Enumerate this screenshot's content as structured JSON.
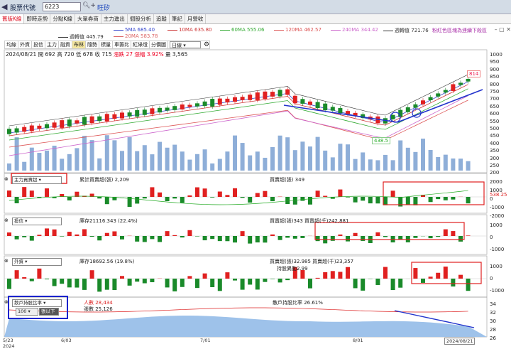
{
  "header": {
    "back_icon": "chevron-left",
    "label": "股票代號",
    "code": "6223",
    "stock_name": "旺矽"
  },
  "tabs": [
    "舊版K線",
    "即時走勢",
    "分點K線",
    "大單券商",
    "主力進出",
    "個股分析",
    "追蹤",
    "筆記",
    "月營收"
  ],
  "ma_legend": {
    "ma5": {
      "label": "5MA",
      "value": "685.40",
      "color": "#3344cc"
    },
    "ma10": {
      "label": "10MA",
      "value": "635.80",
      "color": "#cc3333"
    },
    "ma20": {
      "label": "20MA",
      "value": "583.78",
      "color": "#dd6666"
    },
    "ma60": {
      "label": "60MA",
      "value": "555.06",
      "color": "#33aa33"
    },
    "ma120": {
      "label": "120MA",
      "value": "462.57",
      "color": "#dd5555"
    },
    "ma240": {
      "label": "240MA",
      "value": "344.42",
      "color": "#cc66cc"
    },
    "vol": {
      "label": "週轉值",
      "value": "721.76",
      "color": "#333333"
    },
    "vol2": {
      "label": "週轉值",
      "value": "445.79",
      "color": "#333333"
    }
  },
  "hint": "粉紅色區塊為連續下殺區",
  "subtabs": [
    "均線",
    "外資",
    "投信",
    "主力",
    "融資",
    "布林",
    "隨勢",
    "標量",
    "車籌比",
    "紅綠燈",
    "分價圖"
  ],
  "subtab_active": "布林",
  "period": "日線",
  "info": {
    "date": "2024/08/21",
    "open_label": "開",
    "open": "692",
    "high_label": "高",
    "high": "720",
    "low_label": "低",
    "low": "678",
    "close_label": "收",
    "close": "715",
    "chg_label": "漲跌",
    "chg": "27",
    "pct_label": "漲幅",
    "pct": "3.92%",
    "vol_label": "量",
    "vol": "3,565"
  },
  "price_axis": [
    "1000",
    "950",
    "900",
    "850",
    "800",
    "750",
    "700",
    "650",
    "600",
    "550",
    "500",
    "450",
    "400",
    "350",
    "300",
    "250",
    "200"
  ],
  "price_marks": {
    "high": "814",
    "low": "438.5"
  },
  "panels": {
    "p1": {
      "select": "主力買賣超",
      "legend1": "累計買賣超(張) 2,209",
      "legend2": "買賣超(張) 349",
      "value": "538.25",
      "axis": [
        "2000",
        "1000",
        "0",
        "-1000",
        "-2000"
      ]
    },
    "p2": {
      "select": "投信",
      "legend1": "庫存21116.343 (22.4%)",
      "legend2": "買賣超(張)343 買賣超(千)242,881",
      "axis": [
        "1000",
        "0",
        "-1000"
      ]
    },
    "p3": {
      "select": "外資",
      "legend1": "庫存18692.56 (19.8%)",
      "legend2": "買賣超(張)32.985 買賣超(千)23,357",
      "legend3": "持股異動2.99",
      "axis": [
        "1000",
        "0",
        "-1000"
      ]
    },
    "p4": {
      "select": "散戶持股比率",
      "sub_select": "100",
      "sub_btn": "張以下",
      "legend1": "人數 28,434",
      "legend1b": "張數 25,126",
      "legend2": "散戶持股比率 26.61%",
      "axis": [
        "34",
        "32",
        "30",
        "28",
        "26"
      ]
    }
  },
  "x_labels": [
    "5/23",
    "2024",
    "6/03",
    "7/01",
    "8/01",
    "2024/08/21"
  ]
}
